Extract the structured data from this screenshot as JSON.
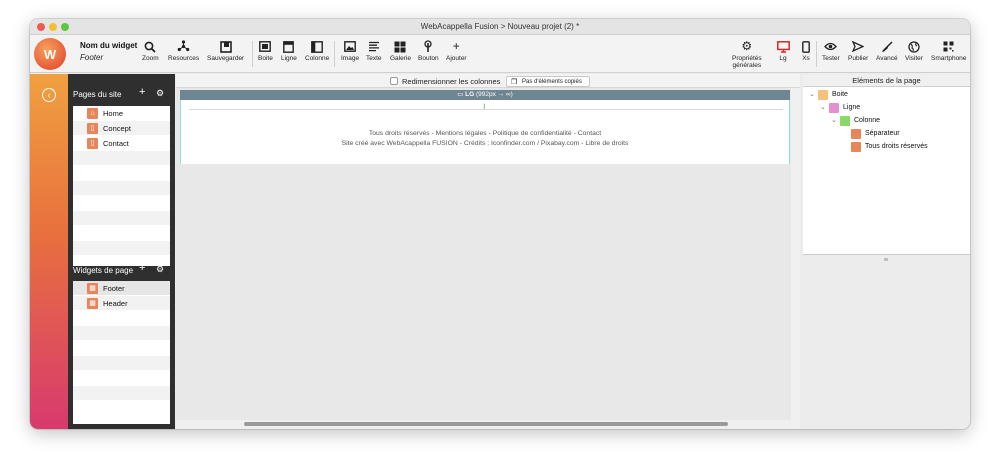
{
  "window": {
    "title": "WebAcappella Fusion > Nouveau projet (2) *"
  },
  "logo": {
    "text": "W"
  },
  "widget": {
    "name_label": "Nom du widget",
    "name_value": "Footer"
  },
  "toolbar": {
    "left": [
      {
        "id": "zoom",
        "label": "Zoom",
        "icon": "search-icon"
      },
      {
        "id": "resources",
        "label": "Resources",
        "icon": "resources-icon"
      },
      {
        "id": "save",
        "label": "Sauvegarder",
        "icon": "save-icon"
      },
      {
        "id": "box",
        "label": "Boite",
        "icon": "box-icon"
      },
      {
        "id": "row",
        "label": "Ligne",
        "icon": "row-icon"
      },
      {
        "id": "column",
        "label": "Colonne",
        "icon": "column-icon"
      },
      {
        "id": "image",
        "label": "Image",
        "icon": "image-icon"
      },
      {
        "id": "text",
        "label": "Texte",
        "icon": "text-icon"
      },
      {
        "id": "gallery",
        "label": "Galerie",
        "icon": "gallery-icon"
      },
      {
        "id": "button",
        "label": "Bouton",
        "icon": "button-icon"
      },
      {
        "id": "add",
        "label": "Ajouter",
        "icon": "plus-icon"
      }
    ],
    "right": [
      {
        "id": "props",
        "label": "Propriétés",
        "label2": "générales",
        "icon": "gear-icon"
      },
      {
        "id": "lg",
        "label": "Lg",
        "icon": "desktop-icon"
      },
      {
        "id": "xs",
        "label": "Xs",
        "icon": "phone-icon"
      },
      {
        "id": "test",
        "label": "Tester",
        "icon": "eye-icon"
      },
      {
        "id": "publish",
        "label": "Publier",
        "icon": "send-icon"
      },
      {
        "id": "advanced",
        "label": "Avancé",
        "icon": "broom-icon"
      },
      {
        "id": "visit",
        "label": "Visiter",
        "icon": "globe-icon"
      },
      {
        "id": "smartphone",
        "label": "Smartphone",
        "icon": "qr-icon"
      }
    ]
  },
  "site_pages": {
    "title": "Pages du site",
    "items": [
      {
        "label": "Home",
        "icon": "home-icon"
      },
      {
        "label": "Concept",
        "icon": "page-icon"
      },
      {
        "label": "Contact",
        "icon": "page-icon"
      }
    ]
  },
  "widgets": {
    "title": "Widgets de page",
    "items": [
      {
        "label": "Footer",
        "icon": "widget-icon"
      },
      {
        "label": "Header",
        "icon": "widget-icon"
      }
    ]
  },
  "canvas": {
    "resize_columns_label": "Redimensionner les colonnes",
    "copied_label": "Pas d'éléments copiés",
    "breakpoint_label": "LG",
    "breakpoint_range": "(992px → ∞)",
    "footer_line1": "Tous droits réservés - Mentions légales - Politique de confidentialité - Contact",
    "footer_line2": "Site créé avec WebAcappella FUSION - Crédits : Iconfinder.com / Pixabay.com - Libre de droits"
  },
  "elements_panel": {
    "title": "Eléments de la page",
    "tree": [
      {
        "label": "Boite",
        "level": 0,
        "type": "box"
      },
      {
        "label": "Ligne",
        "level": 1,
        "type": "row"
      },
      {
        "label": "Colonne",
        "level": 2,
        "type": "column"
      },
      {
        "label": "Séparateur",
        "level": 3,
        "type": "separator"
      },
      {
        "label": "Tous droits réservés",
        "level": 3,
        "type": "text"
      }
    ]
  },
  "colors": {
    "accent_orange": "#e8855a",
    "strip_top": "#f0a040",
    "strip_bottom": "#d83a6e",
    "lg_bar": "#6e8693"
  }
}
